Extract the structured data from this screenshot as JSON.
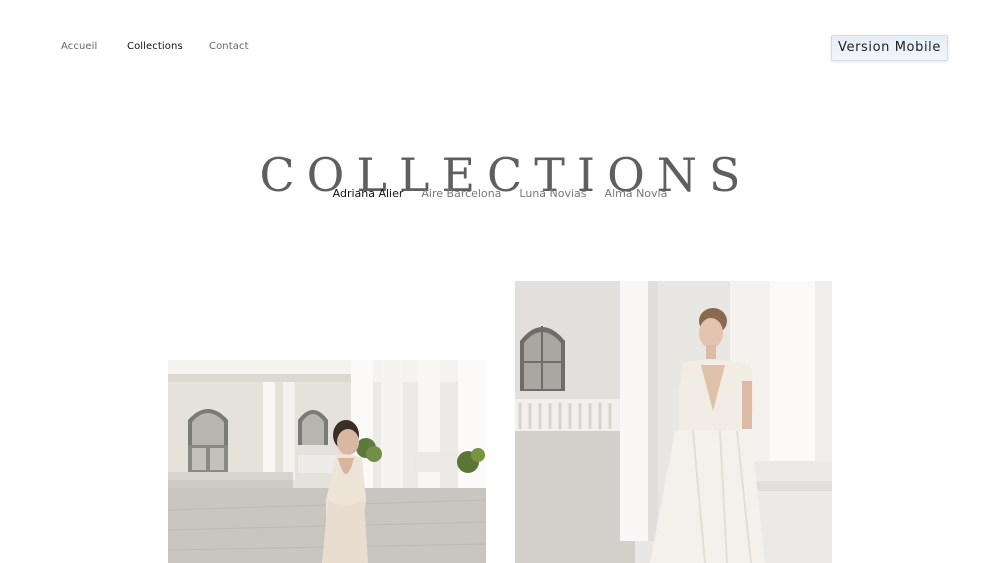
{
  "nav": {
    "items": [
      {
        "label": "Accueil",
        "active": false
      },
      {
        "label": "Collections",
        "active": true
      },
      {
        "label": "Contact",
        "active": false
      }
    ],
    "version_button": "Version Mobile"
  },
  "page": {
    "title": "COLLECTIONS"
  },
  "subnav": {
    "items": [
      {
        "label": "Adriana Alier",
        "active": true
      },
      {
        "label": "Aire Barcelona",
        "active": false
      },
      {
        "label": "Luna Novias",
        "active": false
      },
      {
        "label": "Alma Novia",
        "active": false
      }
    ]
  },
  "gallery": {
    "photos": [
      {
        "alt": "bridal-gown-back-view-photo"
      },
      {
        "alt": "bridal-gown-front-view-photo"
      }
    ]
  }
}
